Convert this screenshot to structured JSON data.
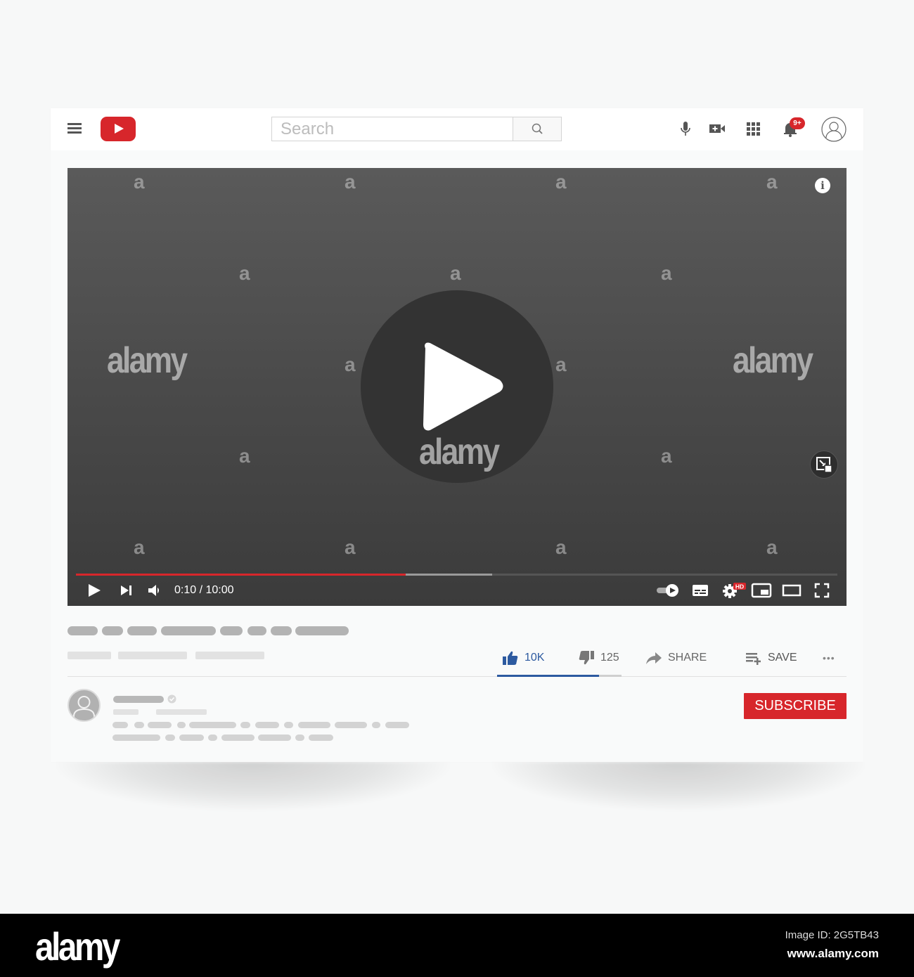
{
  "colors": {
    "brand_red": "#d7262b",
    "like_blue": "#2d5aa0",
    "player_bg_top": "#5a5a5a",
    "player_bg_bottom": "#3b3b3b"
  },
  "header": {
    "menu_icon": "hamburger-menu-icon",
    "logo_icon": "youtube-logo-icon",
    "search": {
      "placeholder": "Search",
      "value": "",
      "button_icon": "search-icon"
    },
    "icons": [
      "microphone-icon",
      "create-video-icon",
      "apps-grid-icon",
      "notifications-bell-icon",
      "account-avatar-icon"
    ],
    "notification_badge": "9+"
  },
  "player": {
    "big_play_icon": "play-icon",
    "info_icon_glyph": "i",
    "miniplayer_icon": "miniplayer-icon",
    "progress": {
      "played_fraction": 0.433,
      "buffered_fraction": 0.547
    },
    "time_current": "0:10",
    "time_total": "10:00",
    "time_display": "0:10 / 10:00",
    "controls_left": [
      "play-icon",
      "next-icon",
      "volume-icon"
    ],
    "controls_right": [
      "autoplay-toggle-icon",
      "subtitles-icon",
      "settings-icon",
      "miniplayer-icon",
      "theater-mode-icon",
      "fullscreen-icon"
    ],
    "settings_badge": "HD"
  },
  "video_info": {
    "actions": {
      "like_count": "10K",
      "dislike_count": "125",
      "share_label": "SHARE",
      "save_label": "SAVE",
      "more_glyph": "•••"
    },
    "like_ratio": 0.82
  },
  "channel": {
    "subscribe_label": "SUBSCRIBE"
  },
  "watermark": {
    "text": "alamy",
    "small_glyph": "a",
    "footer_logo": "alamy",
    "image_id": "Image ID: 2G5TB43",
    "site": "www.alamy.com"
  }
}
